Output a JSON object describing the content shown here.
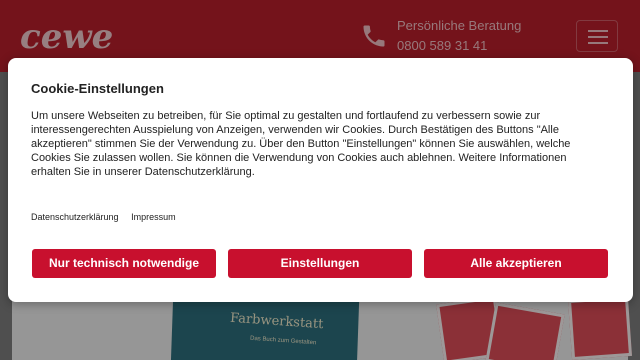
{
  "header": {
    "logo_text": "cewe",
    "consult_label": "Persönliche Beratung",
    "consult_number": "0800 589 31 41"
  },
  "background": {
    "book_title": "Farbwerkstatt",
    "book_subtitle": "Das Buch zum Gestalten"
  },
  "cookie_dialog": {
    "title": "Cookie-Einstellungen",
    "body": "Um unsere Webseiten zu betreiben, für Sie optimal zu gestalten und fortlaufend zu verbessern sowie zur interessengerechten Ausspielung von Anzeigen, verwenden wir Cookies. Durch Bestätigen des Buttons \"Alle akzeptieren\" stimmen Sie der Verwendung zu. Über den Button \"Einstellungen\" können Sie auswählen, welche Cookies Sie zulassen wollen. Sie können die Verwendung von Cookies auch ablehnen. Weitere Informationen erhalten Sie in unserer Datenschutzerklärung.",
    "links": [
      "Datenschutzerklärung",
      "Impressum"
    ],
    "buttons": {
      "necessary": "Nur technisch notwendige",
      "settings": "Einstellungen",
      "accept_all": "Alle akzeptieren"
    }
  },
  "colors": {
    "brand": "#b21e2a",
    "button": "#c8102e"
  }
}
